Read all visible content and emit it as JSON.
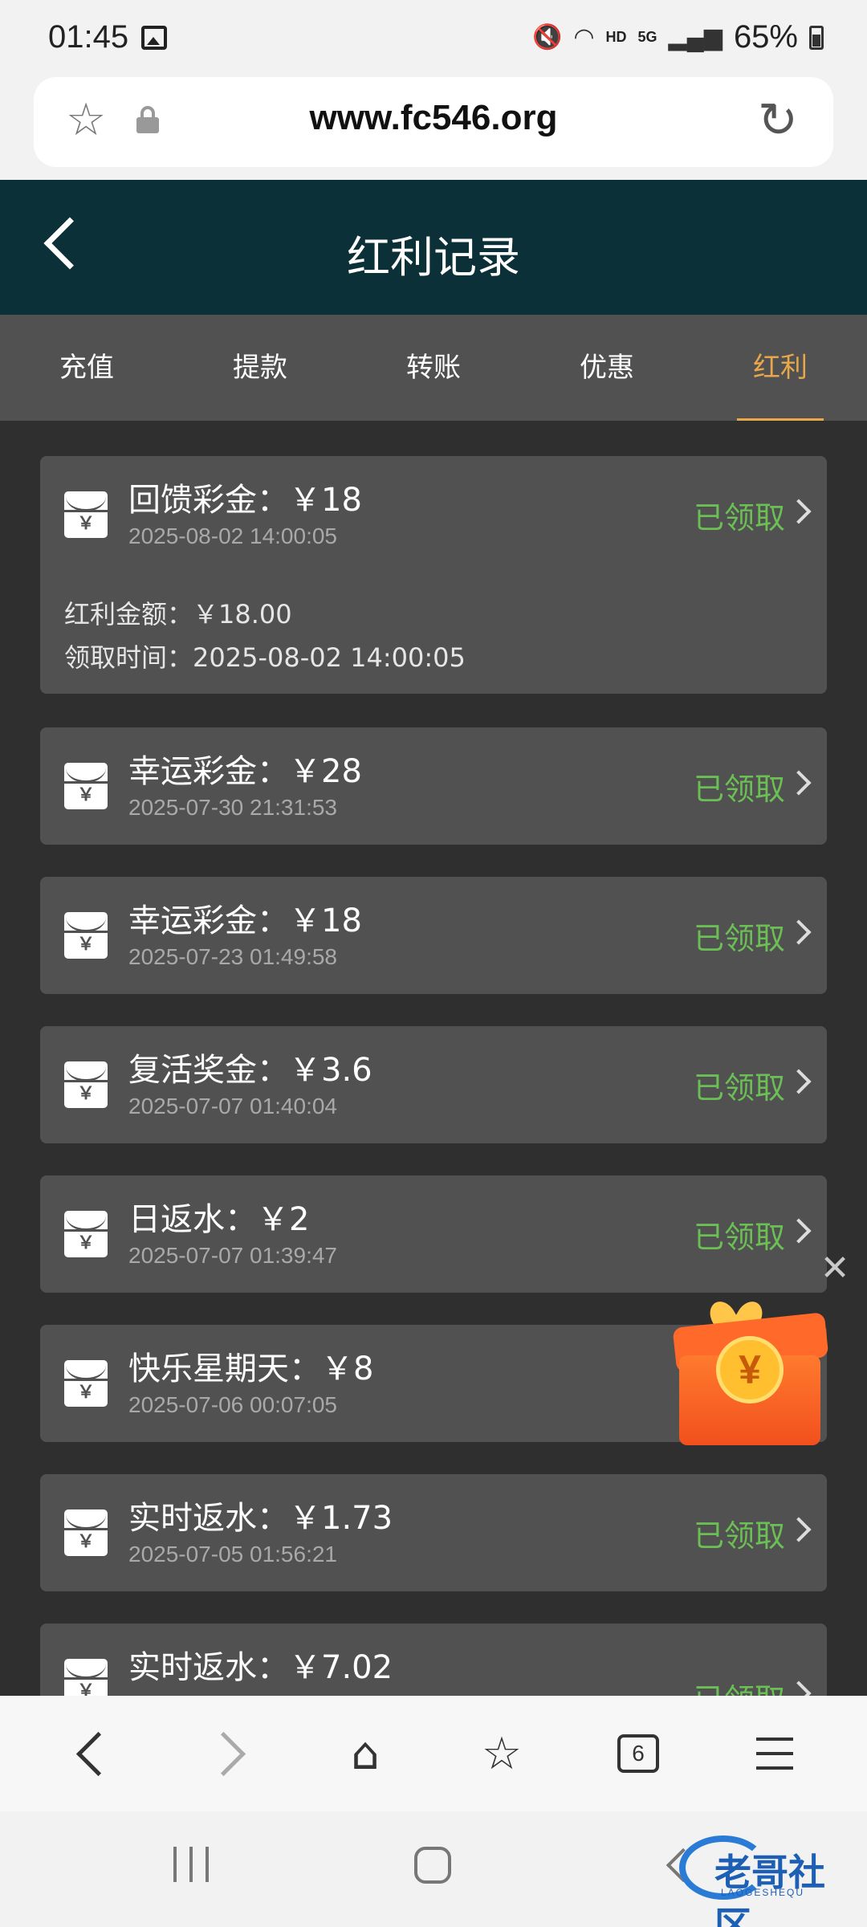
{
  "status_bar": {
    "time": "01:45",
    "network": "HD",
    "network_gen": "5G",
    "battery": "65%",
    "icons": [
      "gallery-icon",
      "mute-icon",
      "wifi-icon",
      "signal-icon",
      "battery-icon"
    ]
  },
  "browser": {
    "url": "www.fc546.org",
    "tab_count": "6"
  },
  "header": {
    "title": "红利记录"
  },
  "tabs": [
    {
      "label": "充值"
    },
    {
      "label": "提款"
    },
    {
      "label": "转账"
    },
    {
      "label": "优惠"
    },
    {
      "label": "红利"
    }
  ],
  "active_tab": "红利",
  "records": [
    {
      "title": "回馈彩金：￥18",
      "date": "2025-08-02 14:00:05",
      "status": "已领取",
      "detail_amount": "红利金额：￥18.00",
      "detail_time": "领取时间：2025-08-02 14:00:05"
    },
    {
      "title": "幸运彩金：￥28",
      "date": "2025-07-30 21:31:53",
      "status": "已领取"
    },
    {
      "title": "幸运彩金：￥18",
      "date": "2025-07-23 01:49:58",
      "status": "已领取"
    },
    {
      "title": "复活奖金：￥3.6",
      "date": "2025-07-07 01:40:04",
      "status": "已领取"
    },
    {
      "title": "日返水：￥2",
      "date": "2025-07-07 01:39:47",
      "status": "已领取"
    },
    {
      "title": "快乐星期天：￥8",
      "date": "2025-07-06 00:07:05",
      "status": ""
    },
    {
      "title": "实时返水：￥1.73",
      "date": "2025-07-05 01:56:21",
      "status": "已领取"
    },
    {
      "title": "实时返水：￥7.02",
      "date": "",
      "status": "已领取"
    }
  ],
  "envelope_symbol": "￥",
  "promo": {
    "coin_symbol": "¥"
  },
  "watermark": {
    "text": "老哥社区",
    "sub": "LAOGESHEQU"
  },
  "colors": {
    "header_bg": "#0c3038",
    "tab_active": "#e8a74a",
    "status_claimed": "#6bbf55",
    "card_bg": "#515151",
    "page_bg": "#2f2f2f"
  }
}
